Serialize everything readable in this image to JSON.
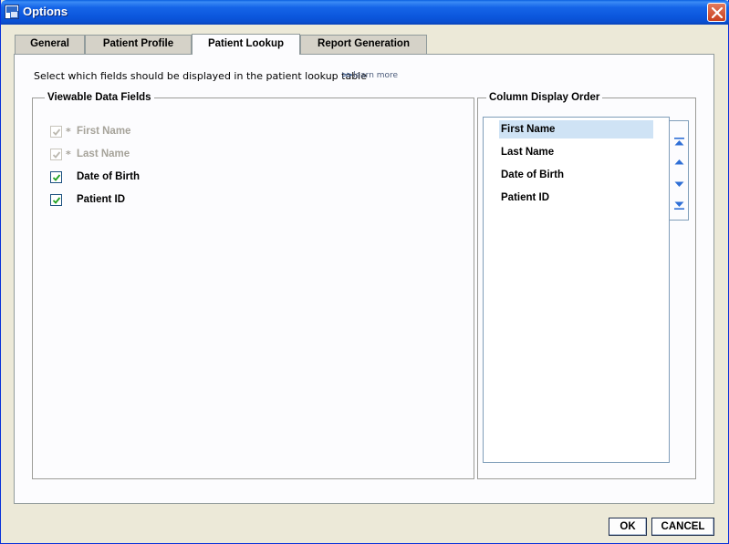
{
  "window": {
    "title": "Options"
  },
  "tabs": [
    {
      "label": "General",
      "active": false
    },
    {
      "label": "Patient Profile",
      "active": false
    },
    {
      "label": "Patient Lookup",
      "active": true
    },
    {
      "label": "Report Generation",
      "active": false
    }
  ],
  "panel": {
    "description": "Select which fields should be displayed in the patient lookup table",
    "learn_more": "learn more"
  },
  "viewable_fields": {
    "title": "Viewable Data Fields",
    "items": [
      {
        "label": "First Name",
        "checked": true,
        "required": true,
        "required_marker": "*",
        "disabled": true
      },
      {
        "label": "Last Name",
        "checked": true,
        "required": true,
        "required_marker": "*",
        "disabled": true
      },
      {
        "label": "Date of Birth",
        "checked": true,
        "required": false,
        "disabled": false
      },
      {
        "label": "Patient ID",
        "checked": true,
        "required": false,
        "disabled": false
      }
    ]
  },
  "column_order": {
    "title": "Column Display Order",
    "items": [
      "First Name",
      "Last Name",
      "Date of Birth",
      "Patient ID"
    ],
    "selected": "First Name",
    "buttons": [
      "move-to-top-icon",
      "move-up-icon",
      "move-down-icon",
      "move-to-bottom-icon"
    ]
  },
  "footer": {
    "ok_label": "OK",
    "cancel_label": "CANCEL"
  },
  "colors": {
    "titlebar": "#0b56dc",
    "dialog_bg": "#ece9d8",
    "panel_bg": "#fcfcfe",
    "selection": "#cfe3f5",
    "check": "#21a121",
    "disabled_text": "#a6a39a",
    "arrow_blue": "#2f6fd6"
  }
}
